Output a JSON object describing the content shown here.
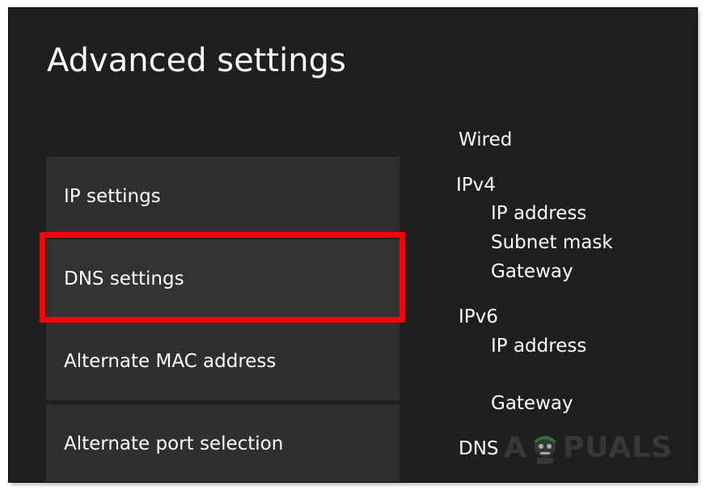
{
  "page": {
    "title": "Advanced settings"
  },
  "menu": {
    "items": [
      {
        "label": "IP settings",
        "selected": false
      },
      {
        "label": "DNS settings",
        "selected": true
      },
      {
        "label": "Alternate MAC address",
        "selected": false
      },
      {
        "label": "Alternate port selection",
        "selected": false
      }
    ]
  },
  "info": {
    "connection": "Wired",
    "ipv4": {
      "heading": "IPv4",
      "ip_address": "IP address",
      "subnet_mask": "Subnet mask",
      "gateway": "Gateway"
    },
    "ipv6": {
      "heading": "IPv6",
      "ip_address": "IP address",
      "gateway": "Gateway"
    },
    "dns": "DNS"
  },
  "highlight": {
    "color": "#ff0000"
  },
  "watermark": {
    "left": "A",
    "right": "PUALS"
  }
}
